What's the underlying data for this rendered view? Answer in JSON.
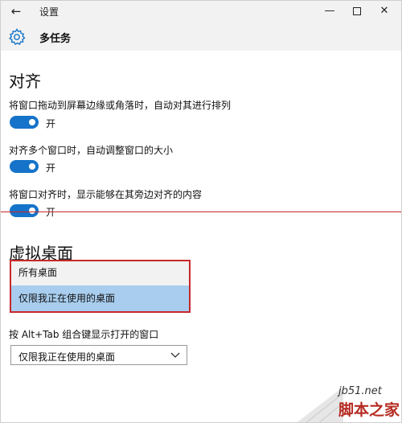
{
  "window": {
    "title": "设置",
    "back_glyph": "←",
    "minimize_glyph": "—",
    "close_glyph": "✕"
  },
  "header": {
    "icon": "gear-icon",
    "title": "多任务"
  },
  "snap": {
    "heading": "对齐",
    "options": [
      {
        "label": "将窗口拖动到屏幕边缘或角落时，自动对其进行排列",
        "state": "开",
        "on": true
      },
      {
        "label": "对齐多个窗口时，自动调整窗口的大小",
        "state": "开",
        "on": true
      },
      {
        "label": "将窗口对齐时，显示能够在其旁边对齐的内容",
        "state": "开",
        "on": true
      }
    ]
  },
  "virtual_desktops": {
    "heading": "虚拟桌面",
    "dropdown_options": [
      "所有桌面",
      "仅限我正在使用的桌面"
    ],
    "highlighted_option": "仅限我正在使用的桌面",
    "alt_tab_label": "按 Alt+Tab 组合键显示打开的窗口",
    "alt_tab_value": "仅限我正在使用的桌面"
  },
  "watermark": {
    "url": "jb51.net",
    "logo": "脚本之家"
  },
  "colors": {
    "accent": "#1573c9",
    "highlight": "#a8cdee",
    "annotation_red": "#c8282a",
    "header_bg": "#f2f2f2"
  }
}
